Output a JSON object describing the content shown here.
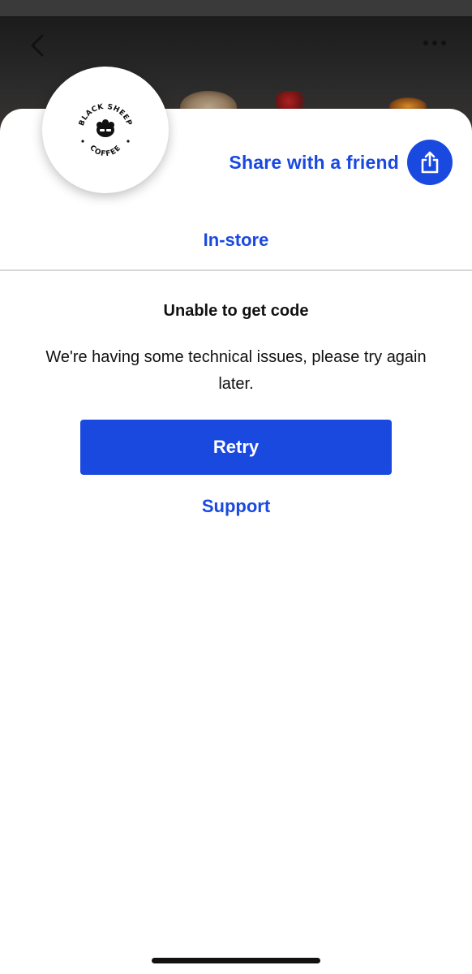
{
  "header": {
    "back_icon": "chevron-left-icon",
    "more_icon": "more-horizontal-icon"
  },
  "brand": {
    "name": "Black Sheep Coffee",
    "logo_line1": "BLACK SHEEP",
    "logo_line2": "COFFEE"
  },
  "share": {
    "label": "Share with a friend",
    "icon": "share-icon"
  },
  "tabs": {
    "active": "In-store"
  },
  "error": {
    "title": "Unable to get code",
    "message": "We're having some technical issues, please try again later."
  },
  "actions": {
    "retry_label": "Retry",
    "support_label": "Support"
  },
  "colors": {
    "accent": "#1a49e0",
    "text": "#111111",
    "divider": "#d6d6d6",
    "background": "#ffffff"
  }
}
